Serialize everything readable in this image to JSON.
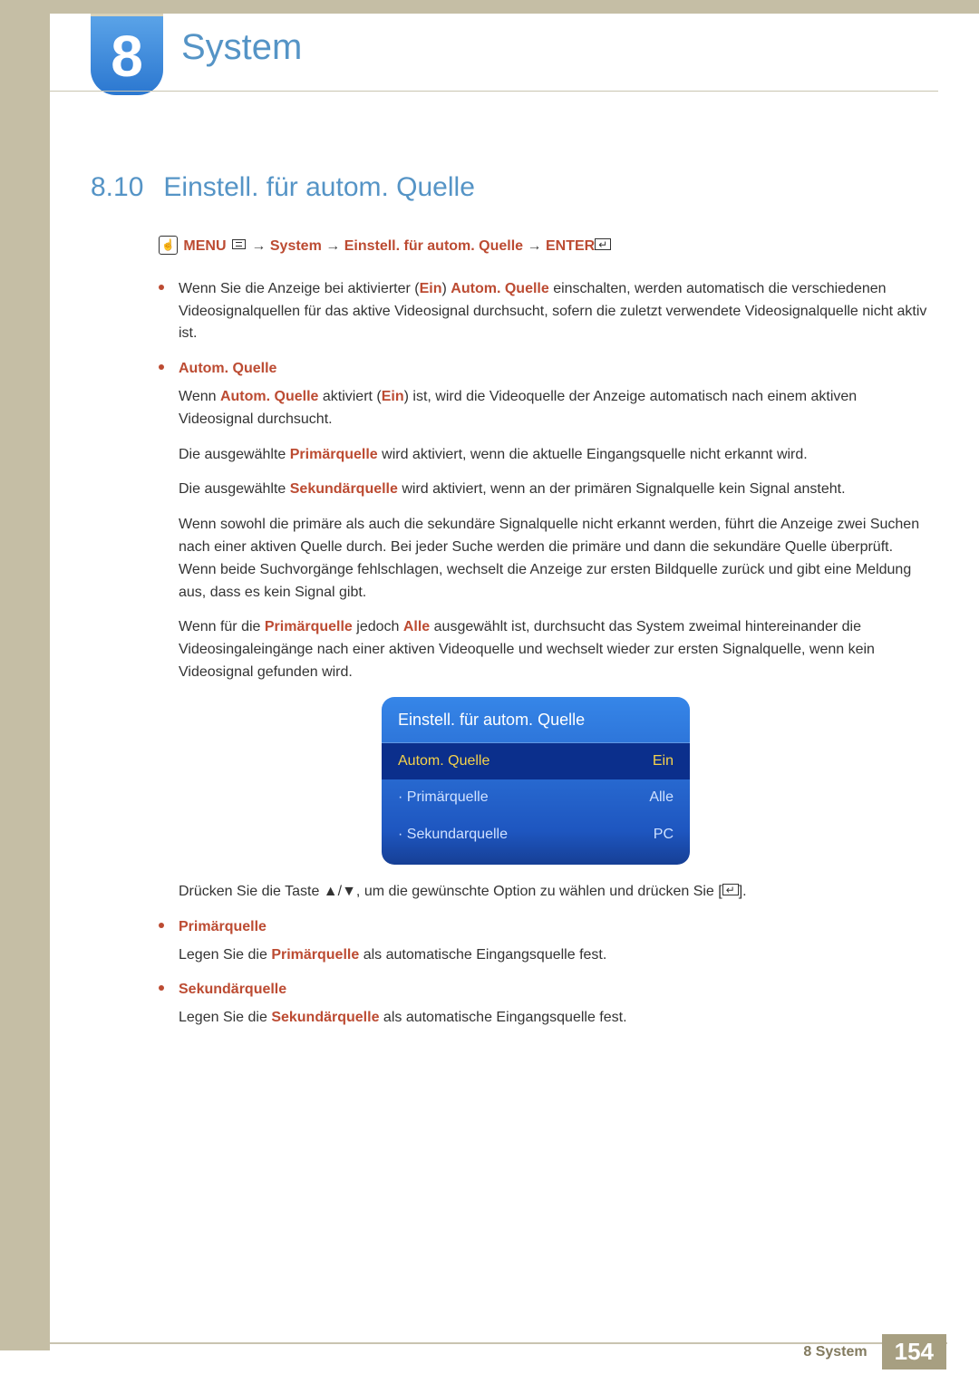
{
  "chapter": {
    "number": "8",
    "title": "System"
  },
  "section": {
    "number": "8.10",
    "title": "Einstell. für autom. Quelle"
  },
  "breadcrumb": {
    "prefix_icon_label": "☝",
    "menu": "MENU",
    "arrow": "→",
    "path1": "System",
    "path2": "Einstell. für autom. Quelle",
    "enter": "ENTER"
  },
  "intro": {
    "t1": "Wenn Sie die Anzeige bei aktivierter (",
    "ein": "Ein",
    "t2": ") ",
    "auto": "Autom. Quelle",
    "t3": " einschalten, werden automatisch die verschiedenen Videosignalquellen für das aktive Videosignal durchsucht, sofern die zuletzt verwendete Videosignalquelle nicht aktiv ist."
  },
  "autom": {
    "head": "Autom. Quelle",
    "p1a": "Wenn ",
    "p1b": "Autom. Quelle",
    "p1c": " aktiviert (",
    "p1d": "Ein",
    "p1e": ") ist, wird die Videoquelle der Anzeige automatisch nach einem aktiven Videosignal durchsucht.",
    "p2a": "Die ausgewählte ",
    "p2b": "Primärquelle",
    "p2c": " wird aktiviert, wenn die aktuelle Eingangsquelle nicht erkannt wird.",
    "p3a": "Die ausgewählte ",
    "p3b": "Sekundärquelle",
    "p3c": " wird aktiviert, wenn an der primären Signalquelle kein Signal ansteht.",
    "p4": "Wenn sowohl die primäre als auch die sekundäre Signalquelle nicht erkannt werden, führt die Anzeige zwei Suchen nach einer aktiven Quelle durch. Bei jeder Suche werden die primäre und dann die sekundäre Quelle überprüft. Wenn beide Suchvorgänge fehlschlagen, wechselt die Anzeige zur ersten Bildquelle zurück und gibt eine Meldung aus, dass es kein Signal gibt.",
    "p5a": "Wenn für die ",
    "p5b": "Primärquelle",
    "p5c": " jedoch ",
    "p5d": "Alle",
    "p5e": " ausgewählt ist, durchsucht das System zweimal hintereinander die Videosingaleingänge nach einer aktiven Videoquelle und wechselt wieder zur ersten Signalquelle, wenn kein Videosignal gefunden wird."
  },
  "osd": {
    "title": "Einstell. für autom. Quelle",
    "rows": [
      {
        "label": "Autom. Quelle",
        "value": "Ein",
        "selected": true
      },
      {
        "label": "· Primärquelle",
        "value": "Alle",
        "selected": false
      },
      {
        "label": "· Sekundarquelle",
        "value": "PC",
        "selected": false
      }
    ]
  },
  "after_osd": {
    "t1": "Drücken Sie die Taste ",
    "arrows": "▲/▼",
    "t2": ", um die gewünschte Option zu wählen und drücken Sie [",
    "t3": "]."
  },
  "primary": {
    "head": "Primärquelle",
    "p1a": "Legen Sie die ",
    "p1b": "Primärquelle",
    "p1c": " als automatische Eingangsquelle fest."
  },
  "secondary": {
    "head": "Sekundärquelle",
    "p1a": "Legen Sie die ",
    "p1b": "Sekundärquelle",
    "p1c": " als automatische Eingangsquelle fest."
  },
  "footer": {
    "text": "8 System",
    "page": "154"
  }
}
